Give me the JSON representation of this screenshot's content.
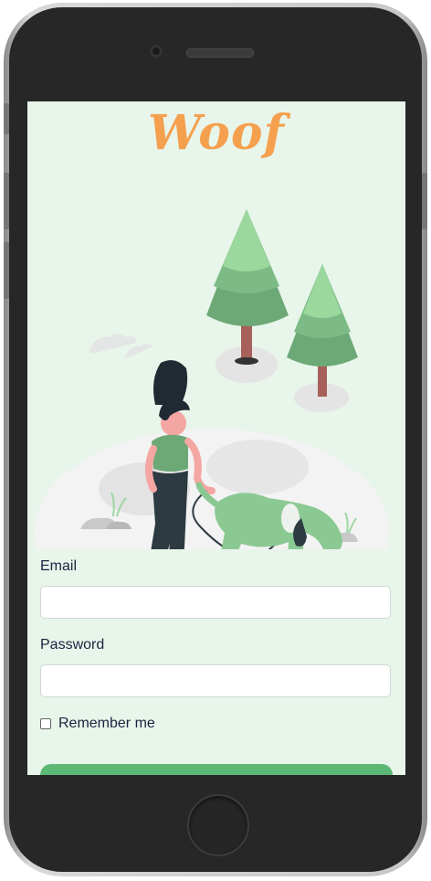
{
  "app": {
    "logo_text": "Woof"
  },
  "form": {
    "email_label": "Email",
    "email_value": "",
    "password_label": "Password",
    "password_value": "",
    "remember_label": "Remember me",
    "remember_checked": false
  },
  "colors": {
    "background": "#e8f5ea",
    "logo": "#f5a04e",
    "accent_green": "#5db876"
  },
  "icons": [
    "camera-icon",
    "speaker-grille",
    "home-button"
  ]
}
